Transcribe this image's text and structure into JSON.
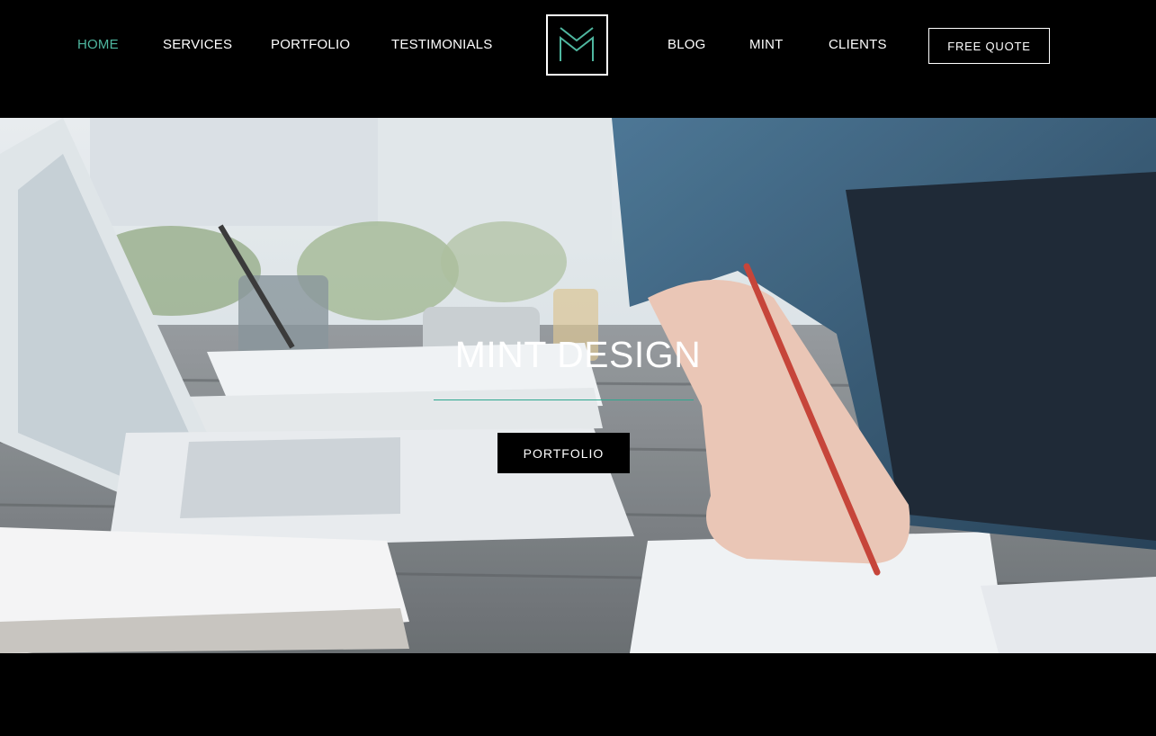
{
  "nav": {
    "left": [
      {
        "label": "HOME",
        "active": true
      },
      {
        "label": "SERVICES",
        "active": false
      },
      {
        "label": "PORTFOLIO",
        "active": false
      },
      {
        "label": "TESTIMONIALS",
        "active": false
      }
    ],
    "right": [
      {
        "label": "BLOG",
        "active": false
      },
      {
        "label": "MINT",
        "active": false
      },
      {
        "label": "CLIENTS",
        "active": false
      }
    ],
    "cta_label": "FREE QUOTE",
    "logo_icon": "m-monogram-icon"
  },
  "hero": {
    "title": "MINT DESIGN",
    "button_label": "PORTFOLIO",
    "background": "desk-laptop-writing-photo"
  },
  "colors": {
    "accent": "#4fb7a0",
    "background": "#000000",
    "text": "#ffffff"
  }
}
